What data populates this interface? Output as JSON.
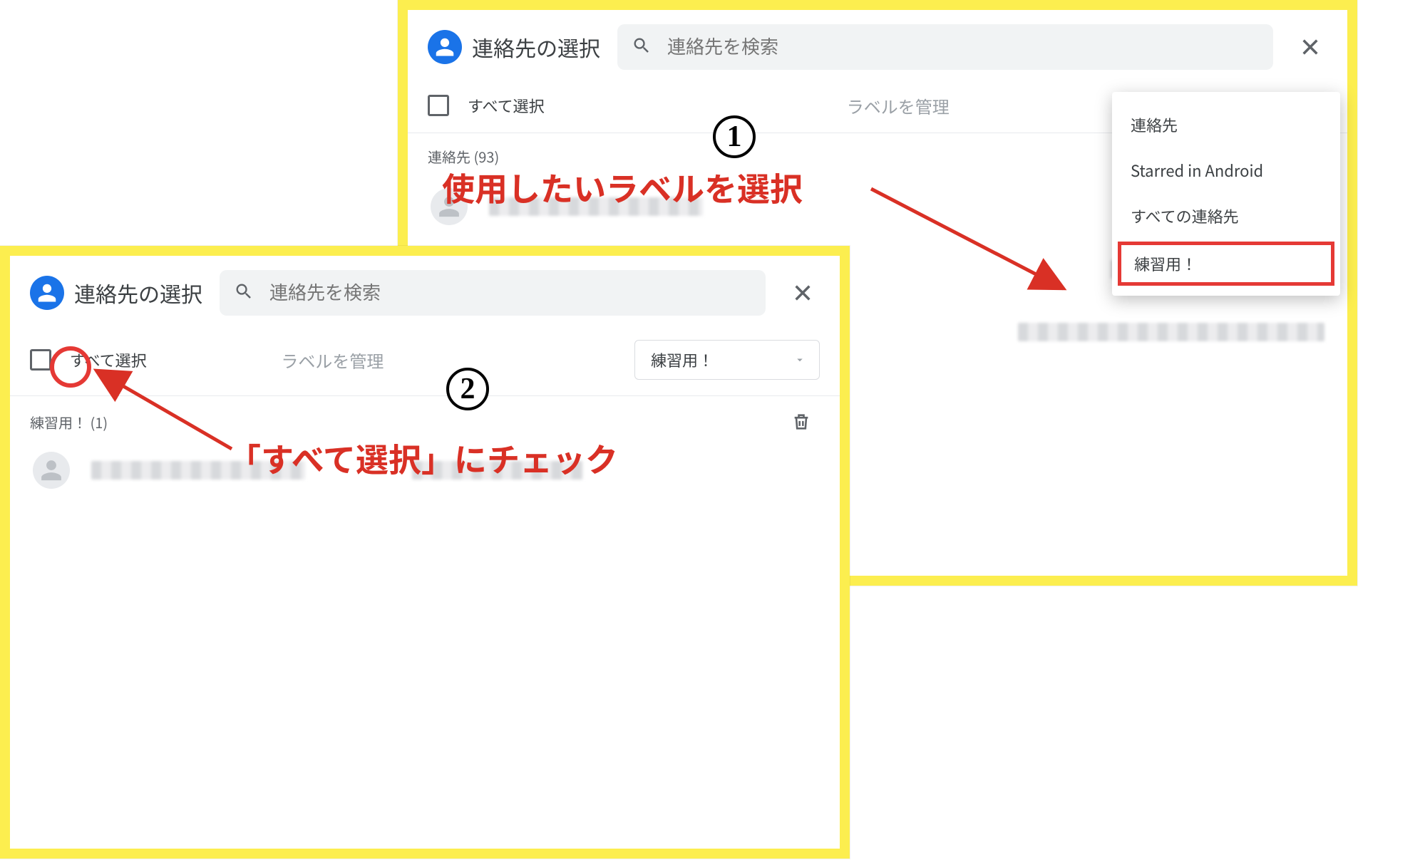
{
  "panel1": {
    "title": "連絡先の選択",
    "search_placeholder": "連絡先を検索",
    "select_all": "すべて選択",
    "manage_labels": "ラベルを管理",
    "annotation": "使用したいラベルを選択",
    "section_label": "連絡先 (93)",
    "menu": {
      "item0": "連絡先",
      "item1": "Starred in Android",
      "item2": "すべての連絡先",
      "item3": "練習用！"
    }
  },
  "panel2": {
    "title": "連絡先の選択",
    "search_placeholder": "連絡先を検索",
    "select_all": "すべて選択",
    "manage_labels": "ラベルを管理",
    "selected_label": "練習用！",
    "section_label": "練習用！ (1)",
    "annotation": "「すべて選択」にチェック"
  },
  "steps": {
    "one": "1",
    "two": "2"
  }
}
